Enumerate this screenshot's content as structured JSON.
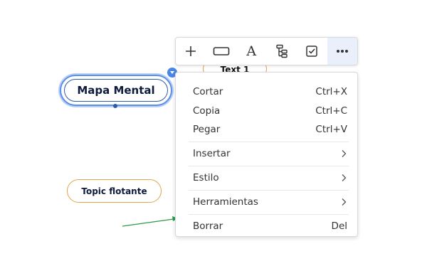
{
  "canvas": {
    "central_topic": "Mapa Mental",
    "child_topic": "Text 1",
    "floating_topic": "Topic flotante"
  },
  "toolbar": {
    "buttons": [
      {
        "name": "add-topic",
        "icon": "plus-icon"
      },
      {
        "name": "shape",
        "icon": "rectangle-icon"
      },
      {
        "name": "text-style",
        "icon": "font-icon",
        "glyph": "A"
      },
      {
        "name": "structure",
        "icon": "tree-structure-icon"
      },
      {
        "name": "task",
        "icon": "checkbox-icon"
      },
      {
        "name": "more",
        "icon": "more-horizontal-icon",
        "active": true
      }
    ]
  },
  "menu": {
    "cut": {
      "label": "Cortar",
      "shortcut": "Ctrl+X"
    },
    "copy": {
      "label": "Copia",
      "shortcut": "Ctrl+C"
    },
    "paste": {
      "label": "Pegar",
      "shortcut": "Ctrl+V"
    },
    "insert": {
      "label": "Insertar"
    },
    "style": {
      "label": "Estilo"
    },
    "tools": {
      "label": "Herramientas"
    },
    "delete": {
      "label": "Borrar",
      "shortcut": "Del"
    }
  },
  "colors": {
    "selection_blue": "#4a86e8",
    "topic_border_orange": "#e3a44a",
    "annotation_arrow_green": "#2e9a48"
  }
}
